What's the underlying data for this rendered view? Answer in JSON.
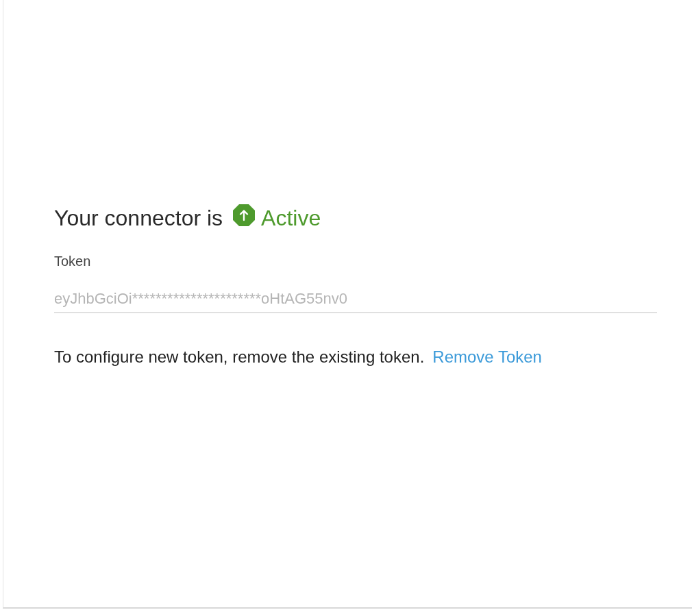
{
  "heading": {
    "text": "Your connector is",
    "status": {
      "label": "Active",
      "active": true
    }
  },
  "token_field": {
    "label": "Token",
    "value": "eyJhbGciOi**********************oHtAG55nv0",
    "disabled": true
  },
  "notice": {
    "text": "To configure new token, remove the existing token.",
    "link": "Remove Token"
  }
}
